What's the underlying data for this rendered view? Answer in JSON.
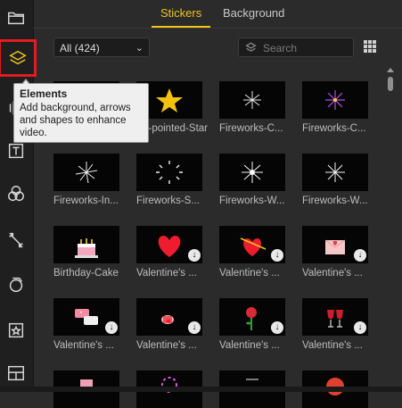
{
  "tabs": [
    {
      "label": "Stickers",
      "active": true
    },
    {
      "label": "Background",
      "active": false
    }
  ],
  "filter": {
    "selected": "All (424)"
  },
  "search": {
    "placeholder": "Search"
  },
  "tooltip": {
    "title": "Elements",
    "body": "Add background, arrows and shapes to enhance video."
  },
  "toolbar": {
    "items": [
      "folder-icon",
      "layers-icon",
      "text-icon",
      "filters-icon",
      "transitions-icon",
      "overlays-icon",
      "star-frame-icon",
      "layout-icon"
    ]
  },
  "stickers": [
    {
      "label": ""
    },
    {
      "label": "Five-pointed-Star"
    },
    {
      "label": "Fireworks-C..."
    },
    {
      "label": "Fireworks-C..."
    },
    {
      "label": "Fireworks-In..."
    },
    {
      "label": "Fireworks-S..."
    },
    {
      "label": "Fireworks-W..."
    },
    {
      "label": "Fireworks-W..."
    },
    {
      "label": "Birthday-Cake"
    },
    {
      "label": "Valentine's ..."
    },
    {
      "label": "Valentine's ..."
    },
    {
      "label": "Valentine's ..."
    },
    {
      "label": "Valentine's ..."
    },
    {
      "label": "Valentine's ..."
    },
    {
      "label": "Valentine's ..."
    },
    {
      "label": "Valentine's ..."
    }
  ],
  "colors": {
    "accent": "#f2c418",
    "highlight": "#e11d1d",
    "panel": "#2b2b2b"
  }
}
